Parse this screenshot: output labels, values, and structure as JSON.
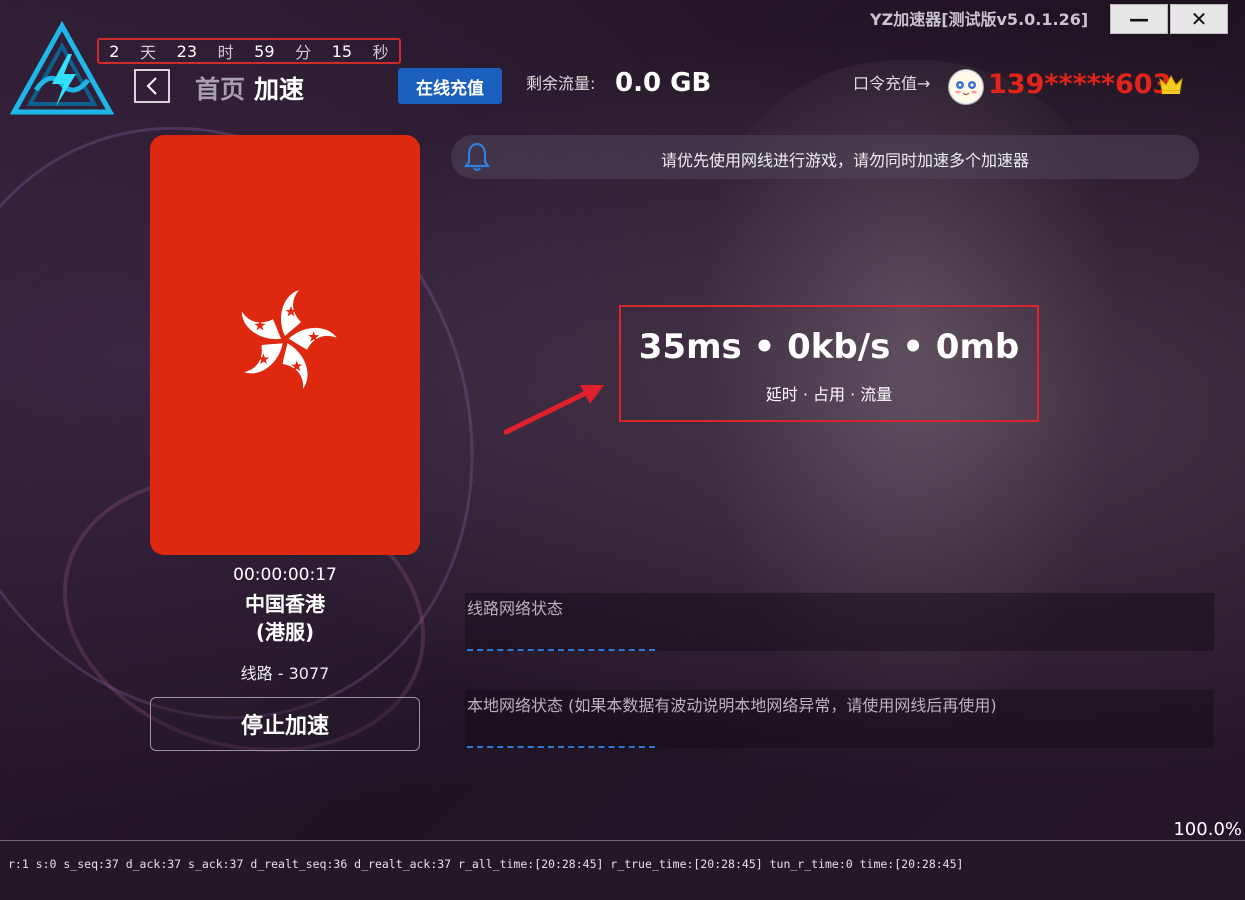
{
  "window": {
    "title": "YZ加速器[测试版v5.0.1.26]",
    "minimize_glyph": "—",
    "close_glyph": "✕"
  },
  "countdown": {
    "days": "2",
    "days_unit": "天",
    "hours": "23",
    "hours_unit": "时",
    "minutes": "59",
    "minutes_unit": "分",
    "seconds": "15",
    "seconds_unit": "秒"
  },
  "nav": {
    "home": "首页",
    "current": "加速",
    "back_icon": "chevron-left-icon"
  },
  "header": {
    "recharge_label": "在线充值",
    "traffic_label": "剩余流量:",
    "traffic_value": "0.0 GB",
    "code_recharge_label": "口令充值→",
    "user_phone": "139*****603",
    "phone_color": "#e3241c",
    "vip_icon": "crown-icon"
  },
  "notice": {
    "icon": "bell-icon",
    "text": "请优先使用网线进行游戏，请勿同时加速多个加速器"
  },
  "node": {
    "flag": "hong-kong-flag",
    "flag_color": "#de2910",
    "elapsed": "00:00:00:17",
    "region": "中国香港",
    "server": "(港服)",
    "line": "线路 - 3077",
    "stop_label": "停止加速"
  },
  "stats": {
    "value": "35ms • 0kb/s • 0mb",
    "label": "延时 · 占用 · 流量",
    "highlight_color": "#d9262d"
  },
  "network": {
    "route_title": "线路网络状态",
    "local_title": "本地网络状态 (如果本数据有波动说明本地网络异常，请使用网线后再使用)"
  },
  "progress": "100.0%",
  "status_line": "r:1 s:0 s_seq:37 d_ack:37 s_ack:37 d_realt_seq:36 d_realt_ack:37 r_all_time:[20:28:45] r_true_time:[20:28:45] tun_r_time:0 time:[20:28:45]"
}
